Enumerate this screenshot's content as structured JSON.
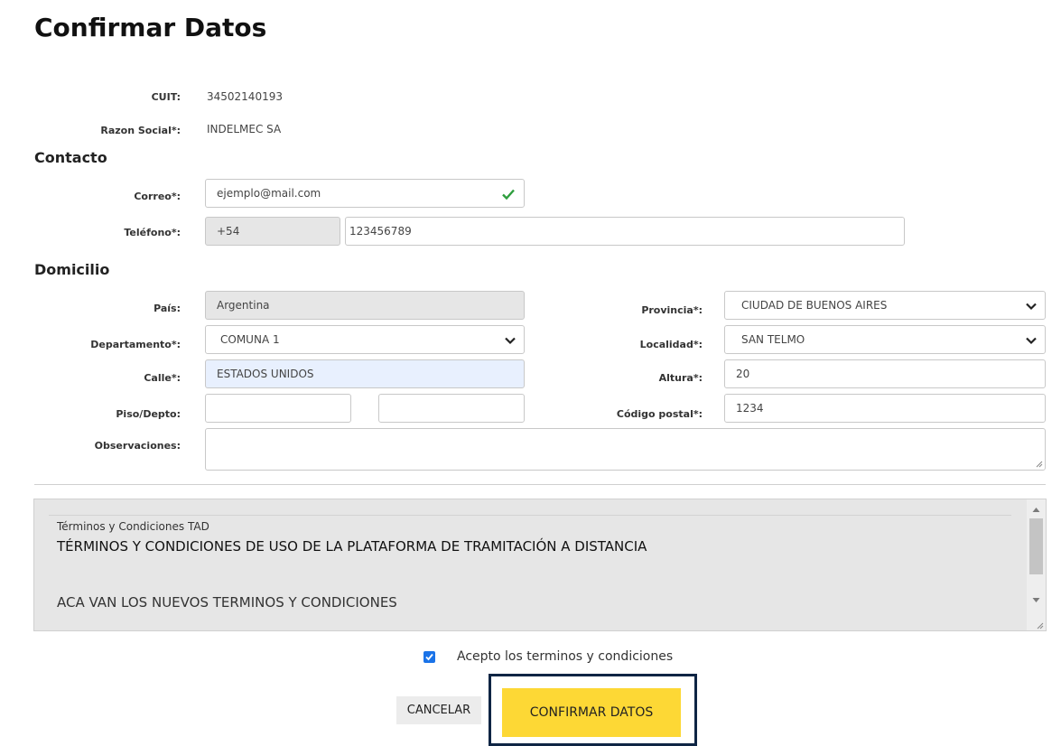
{
  "title": "Confirmar Datos",
  "cuit": {
    "label": "CUIT:",
    "value": "34502140193"
  },
  "razon_social": {
    "label": "Razon Social*:",
    "value": "INDELMEC SA"
  },
  "contacto": {
    "title": "Contacto",
    "correo_label": "Correo*:",
    "correo_value": "ejemplo@mail.com",
    "telefono_label": "Teléfono*:",
    "telefono_prefix": "+54",
    "telefono_value": "123456789"
  },
  "domicilio": {
    "title": "Domicilio",
    "pais_label": "País:",
    "pais_value": "Argentina",
    "departamento_label": "Departamento*:",
    "departamento_value": "COMUNA 1",
    "calle_label": "Calle*:",
    "calle_value": "ESTADOS UNIDOS",
    "piso_label": "Piso/Depto:",
    "piso_value": "",
    "depto_value": "",
    "observaciones_label": "Observaciones:",
    "observaciones_value": "",
    "provincia_label": "Provincia*:",
    "provincia_value": "CIUDAD DE BUENOS AIRES",
    "localidad_label": "Localidad*:",
    "localidad_value": "SAN TELMO",
    "altura_label": "Altura*:",
    "altura_value": "20",
    "cp_label": "Código postal*:",
    "cp_value": "1234"
  },
  "terms": {
    "caption": "Términos y Condiciones TAD",
    "heading": "TÉRMINOS  Y CONDICIONES  DE USO DE LA PLATAFORMA  DE TRAMITACIÓN  A DISTANCIA",
    "body": "ACA VAN LOS NUEVOS TERMINOS Y CONDICIONES"
  },
  "accept_label": "Acepto los terminos y condiciones",
  "buttons": {
    "cancel": "CANCELAR",
    "confirm": "CONFIRMAR DATOS"
  },
  "colors": {
    "confirm_bg": "#fdd835",
    "highlight_outline": "#0f2544",
    "checkbox": "#1a73e8",
    "valid_check": "#2e9e3e"
  }
}
